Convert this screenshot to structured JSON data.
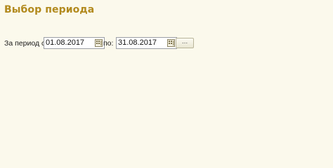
{
  "window": {
    "title": "Выбор периода"
  },
  "period": {
    "from_label": "За период с:",
    "from_value": "01.08.2017",
    "to_label": "по:",
    "to_value": "31.08.2017",
    "more_button_label": "...",
    "calendar_icon": "calendar-icon"
  },
  "colors": {
    "background": "#fbf9ec",
    "title": "#b28a1e"
  }
}
